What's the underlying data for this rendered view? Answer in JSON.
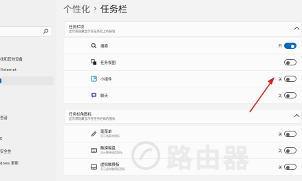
{
  "breadcrumb": {
    "parent": "个性化",
    "separator": "›",
    "current": "任务栏"
  },
  "sidebar": {
    "items": [
      {
        "label": "找和其他设备"
      },
      {
        "label": "!Internet"
      },
      {
        "label": ""
      },
      {
        "label": ""
      },
      {
        "label": "吾音"
      },
      {
        "label": ""
      },
      {
        "label": "E"
      },
      {
        "label": "安全性"
      },
      {
        "label": "dows 更新"
      }
    ]
  },
  "taskbar_items": {
    "title": "任务栏项",
    "subtitle": "显示或隐藏显示在任务栏上的按钮",
    "rows": [
      {
        "label": "搜索",
        "state": "开",
        "on": true
      },
      {
        "label": "任务视图",
        "state": "",
        "on": false
      },
      {
        "label": "小组件",
        "state": "关",
        "on": false
      },
      {
        "label": "聊天",
        "state": "关",
        "on": false
      }
    ]
  },
  "corner_icons": {
    "title": "任务栏角图标",
    "subtitle": "显示或隐藏显示在任务栏角的图标",
    "rows": [
      {
        "label": "笔菜单",
        "sublabel": "显示笔菜单图标",
        "state": "关",
        "on": false
      },
      {
        "label": "触摸键盘",
        "sublabel": "显示触摸键盘图标",
        "state": "关",
        "on": false
      },
      {
        "label": "虚拟触摸板",
        "sublabel": "显示虚拟触摸板图标",
        "state": "关",
        "on": false
      }
    ]
  },
  "watermark": {
    "text": "路由器"
  },
  "colors": {
    "accent": "#0067c0",
    "arrow": "#e02020"
  }
}
